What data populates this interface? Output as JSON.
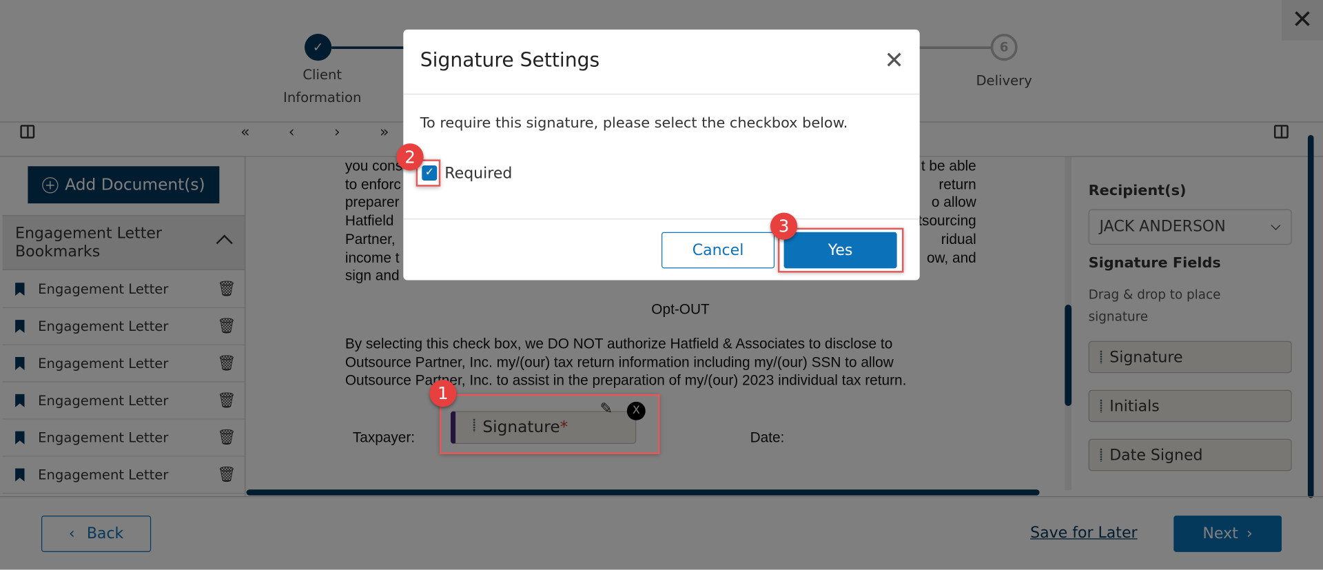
{
  "window": {
    "close_icon": "close-icon"
  },
  "stepper": {
    "steps": [
      {
        "label": "Client Information",
        "state": "complete"
      },
      {
        "label": "Delivery",
        "number": "6",
        "state": "pending"
      }
    ]
  },
  "toolbar": {
    "first": "«",
    "prev": "‹",
    "next": "›",
    "last": "»"
  },
  "sidebar": {
    "add_button": "Add Document(s)",
    "bookmarks_title": "Engagement Letter Bookmarks",
    "bookmarks": [
      "Engagement Letter",
      "Engagement Letter",
      "Engagement Letter",
      "Engagement Letter",
      "Engagement Letter",
      "Engagement Letter"
    ]
  },
  "document": {
    "left_fragments": [
      "you cons",
      "to enforc",
      "preparer",
      "Hatfield",
      "Partner,",
      "income t",
      "sign and"
    ],
    "right_fragments": [
      "t be able",
      "return",
      "o allow",
      "tsourcing",
      "ridual",
      "ow, and"
    ],
    "opt_out_title": "Opt-OUT",
    "opt_out_lines": [
      "By selecting this check box, we DO NOT authorize Hatfield & Associates to disclose to",
      "Outsource Partner, Inc. my/(our) tax return information including my/(our) SSN to allow",
      "Outsource Partner, Inc. to assist in the preparation of my/(our) 2023 individual tax return."
    ],
    "taxpayer_label": "Taxpayer:",
    "date_label": "Date:",
    "placed_field": {
      "label": "Signature",
      "required_mark": "*",
      "delete": "X"
    }
  },
  "right_panel": {
    "recipients_label": "Recipient(s)",
    "recipient_selected": "JACK ANDERSON",
    "fields_title": "Signature Fields",
    "hint": "Drag & drop to place signature",
    "fields": [
      "Signature",
      "Initials",
      "Date Signed"
    ]
  },
  "footer": {
    "back": "Back",
    "save_later": "Save for Later",
    "next": "Next"
  },
  "modal": {
    "title": "Signature Settings",
    "message": "To require this signature, please select the checkbox below.",
    "checkbox_label": "Required",
    "checked": true,
    "cancel": "Cancel",
    "yes": "Yes"
  },
  "annotations": [
    "1",
    "2",
    "3"
  ],
  "colors": {
    "navy": "#03375f",
    "primary": "#0b72b9",
    "badge": "#e8403f"
  }
}
